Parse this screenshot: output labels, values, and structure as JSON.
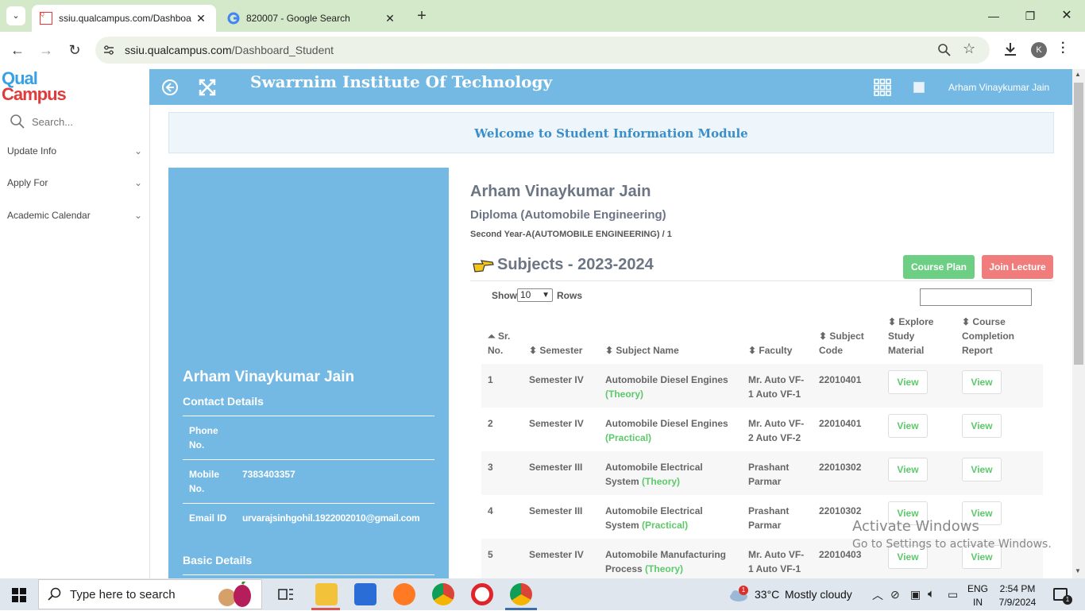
{
  "browser": {
    "tabs": [
      {
        "title": "ssiu.qualcampus.com/Dashboa",
        "active": true
      },
      {
        "title": "820007 - Google Search",
        "active": false
      }
    ],
    "new_tab": "+",
    "url_host": "ssiu.qualcampus.com",
    "url_path": "/Dashboard_Student",
    "profile_initial": "K"
  },
  "app": {
    "logo_line1": "Qual",
    "logo_line2": "Campus",
    "institute": "Swarrnim Institute Of Technology",
    "user": "Arham Vinaykumar Jain",
    "accent": "#74b9e4"
  },
  "sidebar": {
    "search_placeholder": "Search...",
    "items": [
      {
        "label": "Update Info"
      },
      {
        "label": "Apply For"
      },
      {
        "label": "Academic Calendar"
      }
    ]
  },
  "welcome": "Welcome to Student Information Module",
  "profile": {
    "name": "Arham Vinaykumar Jain",
    "contact_heading": "Contact Details",
    "phone_label": "Phone No.",
    "phone_value": "",
    "mobile_label": "Mobile No.",
    "mobile_value": "7383403357",
    "email_label": "Email ID",
    "email_value": "urvarajsinhgohil.1922002010@gmail.com",
    "basic_heading": "Basic Details"
  },
  "student": {
    "name": "Arham Vinaykumar Jain",
    "program": "Diploma (Automobile Engineering)",
    "class": "Second Year-A(AUTOMOBILE ENGINEERING) / 1"
  },
  "subjects": {
    "heading": "Subjects - 2023-2024",
    "course_plan": "Course Plan",
    "join_lecture": "Join Lecture",
    "show_label": "Show",
    "rows_label": "Rows",
    "rows_value": "10",
    "columns": [
      "Sr. No.",
      "Semester",
      "Subject Name",
      "Faculty",
      "Subject Code",
      "Explore Study Material",
      "Course Completion Report"
    ],
    "view_label": "View",
    "rows": [
      {
        "sr": "1",
        "sem": "Semester IV",
        "name": "Automobile Diesel Engines",
        "type": "(Theory)",
        "faculty": "Mr. Auto VF-1 Auto VF-1",
        "code": "22010401"
      },
      {
        "sr": "2",
        "sem": "Semester IV",
        "name": "Automobile Diesel Engines",
        "type": "(Practical)",
        "faculty": "Mr. Auto VF-2 Auto VF-2",
        "code": "22010401"
      },
      {
        "sr": "3",
        "sem": "Semester III",
        "name": "Automobile Electrical System",
        "type": "(Theory)",
        "faculty": "Prashant Parmar",
        "code": "22010302"
      },
      {
        "sr": "4",
        "sem": "Semester III",
        "name": "Automobile Electrical System",
        "type": "(Practical)",
        "faculty": "Prashant Parmar",
        "code": "22010302"
      },
      {
        "sr": "5",
        "sem": "Semester IV",
        "name": "Automobile Manufacturing Process",
        "type": "(Theory)",
        "faculty": "Mr. Auto VF-1 Auto VF-1",
        "code": "22010403"
      }
    ]
  },
  "watermark": {
    "line1": "Activate Windows",
    "line2": "Go to Settings to activate Windows."
  },
  "taskbar": {
    "search_placeholder": "Type here to search",
    "weather_temp": "33°C",
    "weather_text": "Mostly cloudy",
    "weather_badge": "1",
    "lang1": "ENG",
    "lang2": "IN",
    "time": "2:54 PM",
    "date": "7/9/2024",
    "notif_count": "1"
  }
}
